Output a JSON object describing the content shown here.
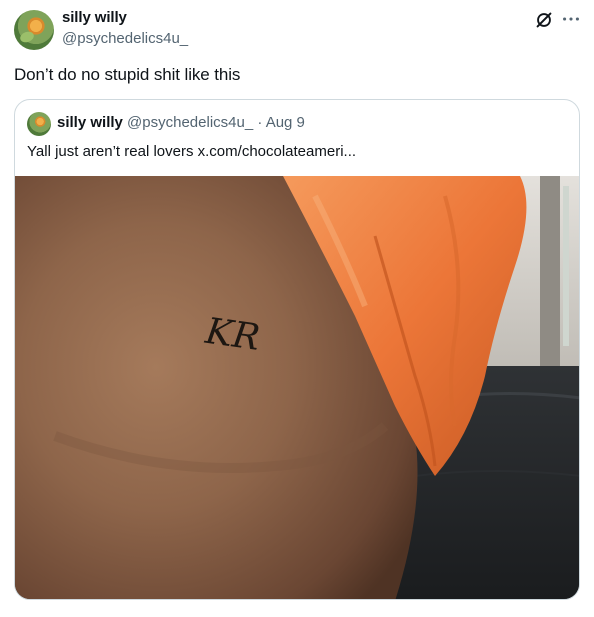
{
  "post": {
    "author_name": "silly willy",
    "author_handle": "@psychedelics4u_",
    "text": "Don’t do no stupid shit like this"
  },
  "quote": {
    "author_name": "silly willy",
    "author_handle": "@psychedelics4u_",
    "separator": "·",
    "date": "Aug 9",
    "text": "Yall just aren’t real lovers",
    "link": "x.com/chocolateameri..."
  },
  "image": {
    "tattoo_text": "KR"
  },
  "icons": {
    "author_avatar": "flower-avatar-icon",
    "grok": "grok-icon",
    "more": "more-dots-icon"
  },
  "colors": {
    "text_primary": "#0f1419",
    "text_secondary": "#536471",
    "border": "#cfd9de",
    "shirt_orange": "#f07a3a"
  }
}
